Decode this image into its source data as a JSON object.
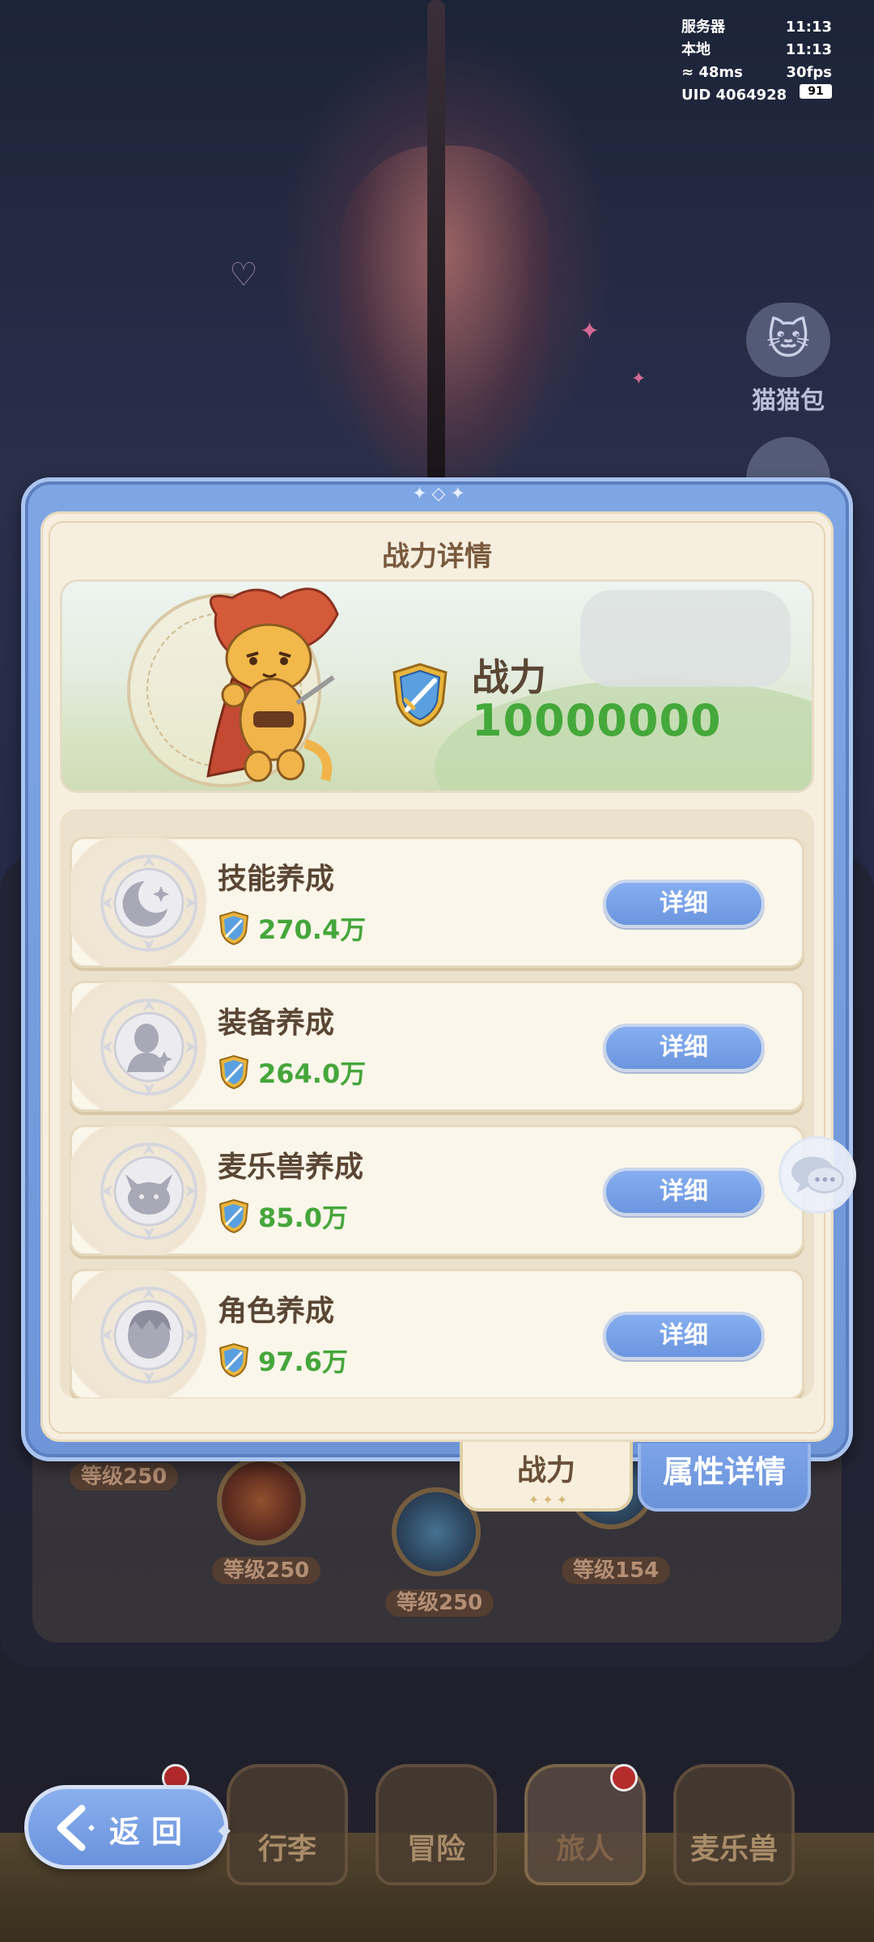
{
  "status": {
    "server_label": "服务器",
    "server_time": "11:13",
    "local_label": "本地",
    "local_time": "11:13",
    "ping": "48ms",
    "fps": "30fps",
    "uid": "UID 4064928",
    "battery": "91"
  },
  "side": {
    "cat_bag_label": "猫猫包"
  },
  "modal": {
    "title": "战力详情",
    "power_label": "战力",
    "power_value": "10000000",
    "items": [
      {
        "title": "技能养成",
        "value": "270.4万",
        "button": "详细",
        "icon": "moon-star-icon"
      },
      {
        "title": "装备养成",
        "value": "264.0万",
        "button": "详细",
        "icon": "figure-sparkle-icon"
      },
      {
        "title": "麦乐兽养成",
        "value": "85.0万",
        "button": "详细",
        "icon": "cat-face-icon"
      },
      {
        "title": "角色养成",
        "value": "97.6万",
        "button": "详细",
        "icon": "character-head-icon"
      }
    ],
    "tabs": {
      "power": "战力",
      "attributes": "属性详情"
    }
  },
  "background": {
    "levels": [
      "等级250",
      "等级250",
      "等级250",
      "等级154"
    ]
  },
  "bottom_nav": {
    "items": [
      "行李",
      "冒险",
      "旅人",
      "麦乐兽"
    ],
    "active": "旅人"
  },
  "back_button": {
    "label": "返回"
  },
  "colors": {
    "accent_blue": "#6d95d8",
    "power_green": "#44a83a",
    "paper": "#f6efdf"
  }
}
